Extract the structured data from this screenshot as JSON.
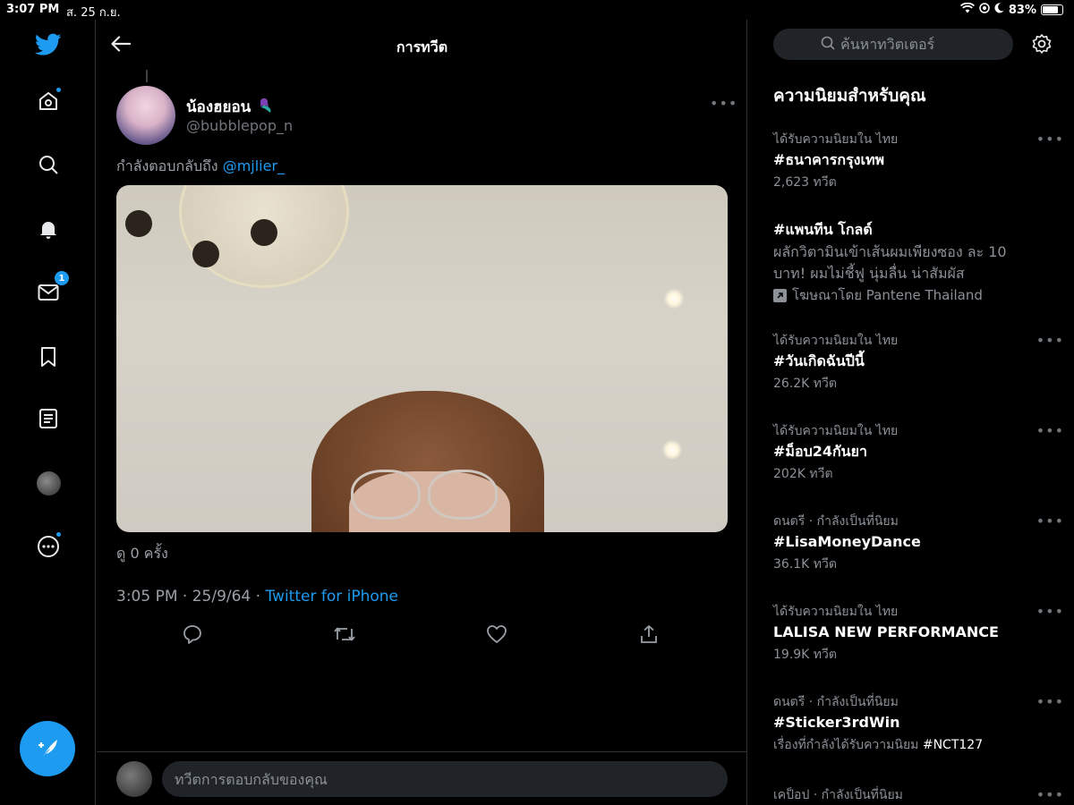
{
  "status_bar": {
    "time": "3:07 PM",
    "date": "ส. 25 ก.ย.",
    "battery_percent": "83%",
    "battery_level": 0.83
  },
  "nav": {
    "messages_badge": "1"
  },
  "main": {
    "title": "การทวีต",
    "tweet": {
      "author_name": "น้องฮยอน",
      "author_handle": "@bubblepop_n",
      "reply_prefix": "กำลังตอบกลับถึง",
      "reply_mention": "@mjlier_",
      "views": "ดู 0 ครั้ง",
      "timestamp": "3:05 PM · 25/9/64 · ",
      "client": "Twitter for iPhone"
    },
    "reply_placeholder": "ทวีตการตอบกลับของคุณ"
  },
  "sidebar": {
    "search_placeholder": "ค้นหาทวิตเตอร์",
    "section_title": "ความนิยมสำหรับคุณ",
    "trends": [
      {
        "context": "ได้รับความนิยมใน ไทย",
        "name": "#ธนาคารกรุงเทพ",
        "count": "2,623 ทวีต"
      },
      {
        "name": "#แพนทีน โกลด์",
        "desc": "ผลักวิตามินเข้าเส้นผมเพียงซอง ละ 10 บาท! ผมไม่ชี้ฟู นุ่มลื่น น่าสัมผัส",
        "promoted": "โฆษณาโดย Pantene Thailand"
      },
      {
        "context": "ได้รับความนิยมใน ไทย",
        "name": "#วันเกิดฉันปีนี้",
        "count": "26.2K ทวีต"
      },
      {
        "context": "ได้รับความนิยมใน ไทย",
        "name": "#ม็อบ24กันยา",
        "count": "202K ทวีต"
      },
      {
        "context": "ดนตรี · กำลังเป็นที่นิยม",
        "name": "#LisaMoneyDance",
        "count": "36.1K ทวีต"
      },
      {
        "context": "ได้รับความนิยมใน ไทย",
        "name": "LALISA NEW PERFORMANCE",
        "count": "19.9K ทวีต"
      },
      {
        "context": "ดนตรี · กำลังเป็นที่นิยม",
        "name": "#Sticker3rdWin",
        "desc_prefix": "เรื่องที่กำลังได้รับความนิยม",
        "desc_tag": "#NCT127"
      },
      {
        "context": "เคป็อป · กำลังเป็นที่นิยม"
      }
    ]
  }
}
